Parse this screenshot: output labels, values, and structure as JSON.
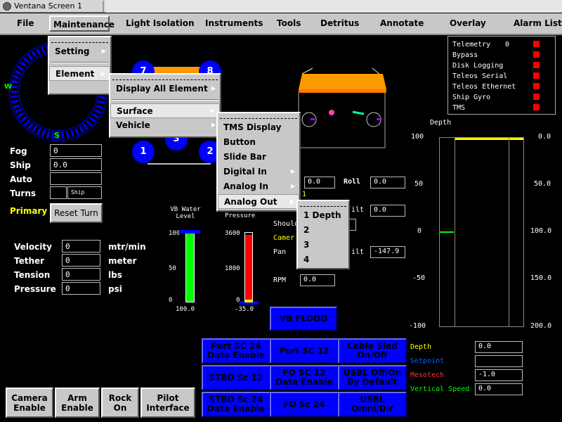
{
  "window": {
    "title": "Ventana Screen 1"
  },
  "menubar": {
    "file": "File",
    "maintenance": "Maintenance",
    "light_isolation": "Light Isolation",
    "instruments": "Instruments",
    "tools": "Tools",
    "detritus": "Detritus",
    "annotate": "Annotate",
    "overlay": "Overlay",
    "alarm_list": "Alarm List"
  },
  "maintenance_menu": {
    "setting": "Setting",
    "element": "Element"
  },
  "element_menu": {
    "display_all": "Display All Element",
    "surface": "Surface",
    "vehicle": "Vehicle"
  },
  "surface_menu": {
    "tms_display": "TMS Display",
    "button": "Button",
    "slide_bar": "Slide Bar",
    "digital_in": "Digital In",
    "analog_in": "Analog In",
    "analog_out": "Analog Out"
  },
  "analog_out_menu": {
    "item1": "1 Depth",
    "item2": "2",
    "item3": "3",
    "item4": "4"
  },
  "compass": {
    "w": "W",
    "s": "S"
  },
  "left_panel": {
    "fog_label": "Fog",
    "fog_value": "0",
    "ship_label": "Ship",
    "ship_value": "0.0",
    "auto_label": "Auto",
    "auto_value": "",
    "turns_label": "Turns",
    "turns_value": "",
    "turns_ship": "Ship",
    "primary_label": "Primary",
    "reset_turn": "Reset Turn"
  },
  "tether_stats": {
    "velocity_label": "Velocity",
    "velocity_value": "0",
    "velocity_unit": "mtr/min",
    "tether_label": "Tether",
    "tether_value": "0",
    "tether_unit": "meter",
    "tension_label": "Tension",
    "tension_value": "0",
    "tension_unit": "lbs",
    "pressure_label": "Pressure",
    "pressure_value": "0",
    "pressure_unit": "psi"
  },
  "thrusters": {
    "t1": "1",
    "t2": "2",
    "t3": "3",
    "t7": "7",
    "t8": "8"
  },
  "bottom_buttons": {
    "camera": "Camera Enable",
    "arm": "Arm Enable",
    "rock": "Rock On",
    "pilot": "Pilot Interface"
  },
  "vb_gauge": {
    "title": "VB Water Level",
    "top": "100",
    "mid": "50",
    "bottom": "0",
    "readout": "100.0",
    "level_fraction": 1.0,
    "color": "#00ff00"
  },
  "pressure_gauge": {
    "title": "Pressure",
    "top": "3600",
    "mid": "1800",
    "bottom": "0",
    "readout": "-35.0",
    "level_fraction": 0.97,
    "color": "#ff0000"
  },
  "attitude": {
    "field1_value": "0.0",
    "roll_label": "Roll",
    "roll_value": "0.0",
    "yellow_digit": "1",
    "tilt1_label": "ilt",
    "tilt1_value": "0.0",
    "shoulder_label": "Should",
    "camera_label": "Camer",
    "pan_label": "Pan",
    "tilt2_label": "ilt",
    "tilt2_value": "-147.9",
    "rpm_label": "RPM",
    "rpm_value": "0.0"
  },
  "vb_flood": "VB FLOOD",
  "control_buttons": [
    [
      "Port SC 24 Data Enable",
      "Port SC 12",
      "Cable Sled On/Off"
    ],
    [
      "STBD Sc 12",
      "FO SC 12 Data Enable",
      "USBL Off/On By Default"
    ],
    [
      "STBD Sc 24 Data Enable",
      "FO Sc 24",
      "USBL Omni/Dir"
    ]
  ],
  "telemetry": [
    {
      "label": "Telemetry",
      "value": "0"
    },
    {
      "label": "Bypass",
      "value": ""
    },
    {
      "label": "Disk Logging",
      "value": ""
    },
    {
      "label": "Teleos Serial",
      "value": ""
    },
    {
      "label": "Teleos Ethernet",
      "value": ""
    },
    {
      "label": "Ship Gyro",
      "value": ""
    },
    {
      "label": "TMS",
      "value": ""
    }
  ],
  "depth": {
    "title": "Depth",
    "left_ticks": [
      "100",
      "50",
      "0",
      "-50",
      "-100"
    ],
    "right_ticks": [
      "0.0",
      "50.0",
      "100.0",
      "150.0",
      "200.0"
    ],
    "marker_value": 0,
    "depth_value": 0.0
  },
  "depth_stats": {
    "depth_label": "Depth",
    "depth_value": "0.0",
    "setpoint_label": "Setpoint",
    "setpoint_value": "",
    "mesotech_label": "Mesotech",
    "mesotech_value": "-1.0",
    "vspeed_label": "Vertical Speed",
    "vspeed_value": "0.0"
  },
  "colors": {
    "accent_blue": "#0000ff",
    "led_red": "#ff0000",
    "vb_green": "#00ff00",
    "yellow": "#ffff00",
    "vehicle_orange": "#ff9900"
  }
}
